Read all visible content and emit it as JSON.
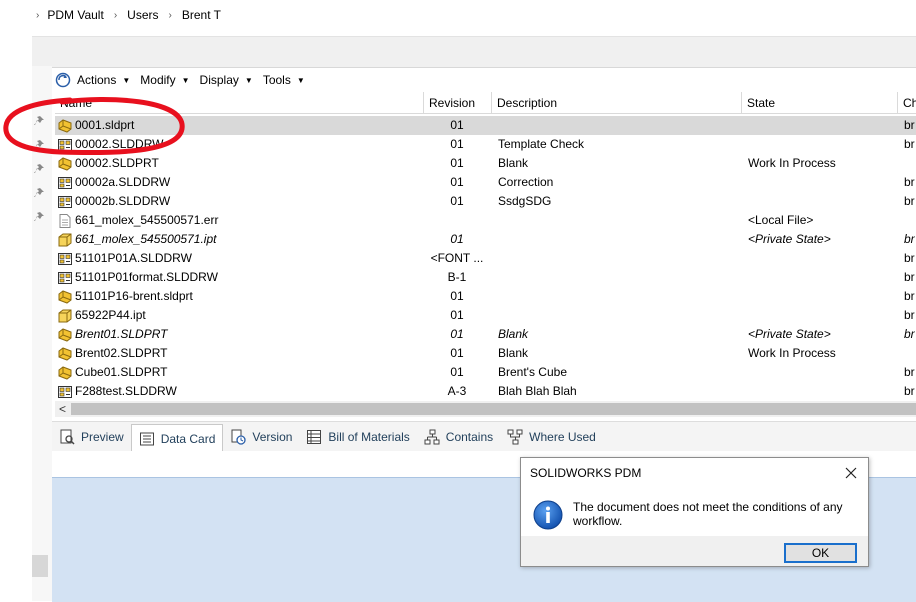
{
  "breadcrumb": {
    "items": [
      "PDM Vault",
      "Users",
      "Brent T"
    ]
  },
  "toolbar": {
    "actions": "Actions",
    "modify": "Modify",
    "display": "Display",
    "tools": "Tools"
  },
  "columns": {
    "name": "Name",
    "revision": "Revision",
    "description": "Description",
    "state": "State",
    "checked": "Ch"
  },
  "rows": [
    {
      "name": "0001.sldprt",
      "icon": "part",
      "revision": "01",
      "description": "",
      "state": "",
      "ch": "br",
      "selected": true
    },
    {
      "name": "00002.SLDDRW",
      "icon": "drawing",
      "revision": "01",
      "description": "Template Check",
      "state": "",
      "ch": "br"
    },
    {
      "name": "00002.SLDPRT",
      "icon": "part",
      "revision": "01",
      "description": "Blank",
      "state": "Work In Process",
      "ch": ""
    },
    {
      "name": "00002a.SLDDRW",
      "icon": "drawing",
      "revision": "01",
      "description": "Correction",
      "state": "",
      "ch": "br"
    },
    {
      "name": "00002b.SLDDRW",
      "icon": "drawing",
      "revision": "01",
      "description": "SsdgSDG",
      "state": "",
      "ch": "br"
    },
    {
      "name": "661_molex_545500571.err",
      "icon": "text",
      "revision": "",
      "description": "",
      "state": "<Local File>",
      "ch": ""
    },
    {
      "name": "661_molex_545500571.ipt",
      "icon": "ipt",
      "revision": "01",
      "description": "",
      "state": "<Private State>",
      "ch": "br",
      "italic": true
    },
    {
      "name": "51101P01A.SLDDRW",
      "icon": "drawing",
      "revision": "<FONT ...",
      "description": "",
      "state": "",
      "ch": "br"
    },
    {
      "name": "51101P01format.SLDDRW",
      "icon": "drawing",
      "revision": "B-1",
      "description": "",
      "state": "",
      "ch": "br"
    },
    {
      "name": "51101P16-brent.sldprt",
      "icon": "part",
      "revision": "01",
      "description": "",
      "state": "",
      "ch": "br"
    },
    {
      "name": "65922P44.ipt",
      "icon": "ipt",
      "revision": "01",
      "description": "",
      "state": "",
      "ch": "br"
    },
    {
      "name": "Brent01.SLDPRT",
      "icon": "part",
      "revision": "01",
      "description": "Blank",
      "state": "<Private State>",
      "ch": "br",
      "italic": true
    },
    {
      "name": "Brent02.SLDPRT",
      "icon": "part",
      "revision": "01",
      "description": "Blank",
      "state": "Work In Process",
      "ch": ""
    },
    {
      "name": "Cube01.SLDPRT",
      "icon": "part",
      "revision": "01",
      "description": "Brent's Cube",
      "state": "",
      "ch": "br"
    },
    {
      "name": "F288test.SLDDRW",
      "icon": "drawing",
      "revision": "A-3",
      "description": "Blah Blah Blah",
      "state": "",
      "ch": "br"
    }
  ],
  "tabs": [
    {
      "label": "Preview",
      "icon": "preview-icon"
    },
    {
      "label": "Data Card",
      "icon": "data-card-icon",
      "active": true
    },
    {
      "label": "Version",
      "icon": "version-icon"
    },
    {
      "label": "Bill of Materials",
      "icon": "bom-icon"
    },
    {
      "label": "Contains",
      "icon": "contains-icon"
    },
    {
      "label": "Where Used",
      "icon": "where-used-icon"
    }
  ],
  "dialog": {
    "title": "SOLIDWORKS PDM",
    "message": "The document does not meet the conditions of any workflow.",
    "ok_label": "OK"
  },
  "colors": {
    "selection": "#d9d9d9",
    "annotation": "#e8101e",
    "pane": "#d3e2f3",
    "accent": "#1a6fcc"
  }
}
